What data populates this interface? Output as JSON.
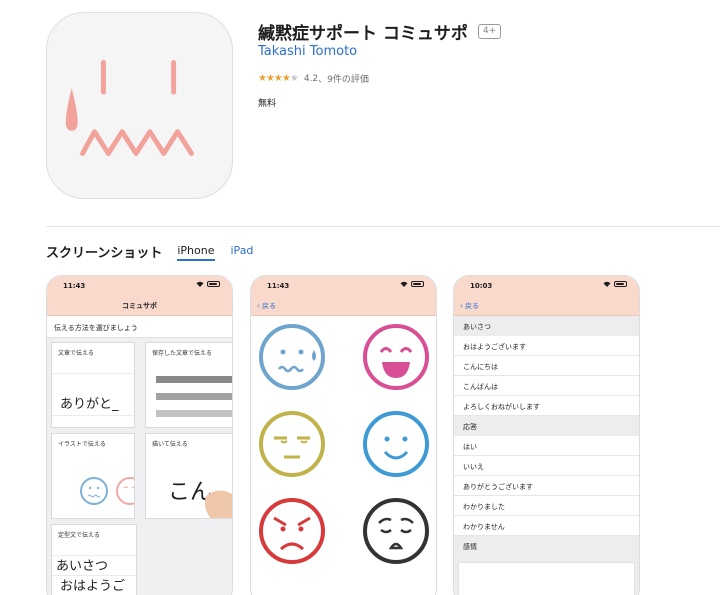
{
  "app": {
    "title": "緘黙症サポート コミュサポ",
    "age_rating": "4+",
    "developer": "Takashi Tomoto",
    "rating_value": "4.2",
    "rating_count": "、9件の評価",
    "price": "無料",
    "icon_name": "tearful-grimace-face-icon"
  },
  "screenshots": {
    "title": "スクリーンショット",
    "tabs": [
      {
        "label": "iPhone",
        "active": true
      },
      {
        "label": "iPad",
        "active": false
      }
    ]
  },
  "phone1": {
    "time": "11:43",
    "nav_title": "コミュサポ",
    "instruction": "伝える方法を選びましょう",
    "tiles": {
      "text_label": "文章で伝える",
      "text_sample": "ありがと_",
      "saved_label": "保存した文章で伝える",
      "illust_label": "イラストで伝える",
      "draw_label": "描いて伝える",
      "draw_sample": "こん",
      "template_label": "定型文で伝える",
      "template_line1": "あいさつ",
      "template_line2": "おはようご"
    }
  },
  "phone2": {
    "time": "11:43",
    "back_label": "戻る"
  },
  "phone3": {
    "time": "10:03",
    "back_label": "戻る",
    "sections": [
      {
        "header": "あいさつ",
        "items": [
          "おはようございます",
          "こんにちは",
          "こんばんは",
          "よろしくおねがいします"
        ]
      },
      {
        "header": "応答",
        "items": [
          "はい",
          "いいえ",
          "ありがとうございます",
          "わかりました",
          "わかりません"
        ]
      },
      {
        "header": "感情",
        "items": []
      }
    ]
  },
  "colors": {
    "accent": "#2b6fd0",
    "nav_bar": "#f8d9cc",
    "stars": "#e9a23b",
    "icon_pink": "#f2a29a"
  }
}
